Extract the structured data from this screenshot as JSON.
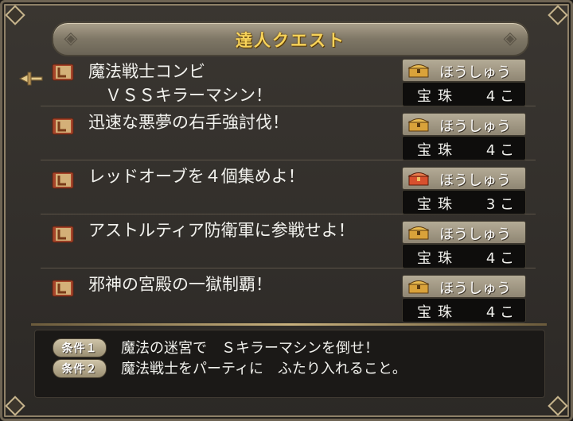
{
  "header": {
    "title": "達人クエスト"
  },
  "quests": [
    {
      "title": "魔法戦士コンビ\n　ＶＳＳキラーマシン！",
      "reward_label": "ほうしゅう",
      "reward_item": "宝珠",
      "reward_count": "4 こ",
      "chest": "gold"
    },
    {
      "title": "迅速な悪夢の右手強討伐！",
      "reward_label": "ほうしゅう",
      "reward_item": "宝珠",
      "reward_count": "4 こ",
      "chest": "gold"
    },
    {
      "title": "レッドオーブを４個集めよ！",
      "reward_label": "ほうしゅう",
      "reward_item": "宝珠",
      "reward_count": "3 こ",
      "chest": "red"
    },
    {
      "title": "アストルティア防衛軍に参戦せよ！",
      "reward_label": "ほうしゅう",
      "reward_item": "宝珠",
      "reward_count": "4 こ",
      "chest": "gold"
    },
    {
      "title": "邪神の宮殿の一獄制覇！",
      "reward_label": "ほうしゅう",
      "reward_item": "宝珠",
      "reward_count": "4 こ",
      "chest": "gold"
    }
  ],
  "conditions": [
    {
      "badge": "条件１",
      "text": "魔法の迷宮で　Ｓキラーマシンを倒せ！"
    },
    {
      "badge": "条件２",
      "text": "魔法戦士をパーティに　ふたり入れること。"
    }
  ],
  "colors": {
    "title_gold": "#f7d35a",
    "chest_gold": "#d9a23a",
    "chest_red": "#d8502e"
  }
}
